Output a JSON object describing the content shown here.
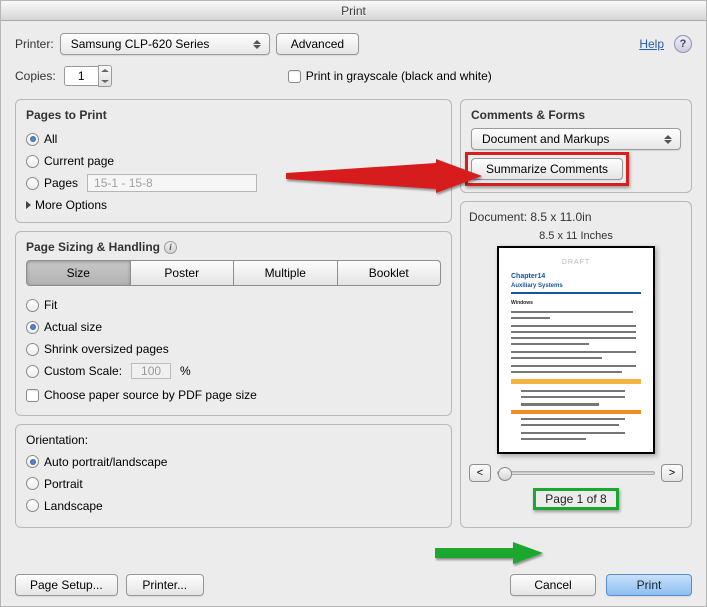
{
  "window_title": "Print",
  "header": {
    "printer_label": "Printer:",
    "printer_value": "Samsung CLP-620 Series",
    "advanced_label": "Advanced",
    "help_label": "Help",
    "copies_label": "Copies:",
    "copies_value": "1",
    "grayscale_label": "Print in grayscale (black and white)"
  },
  "pages_to_print": {
    "title": "Pages to Print",
    "all": "All",
    "current": "Current page",
    "pages": "Pages",
    "pages_value": "15-1 - 15-8",
    "more_options": "More Options"
  },
  "sizing": {
    "title": "Page Sizing & Handling",
    "size": "Size",
    "poster": "Poster",
    "multiple": "Multiple",
    "booklet": "Booklet",
    "fit": "Fit",
    "actual": "Actual size",
    "shrink": "Shrink oversized pages",
    "custom": "Custom Scale:",
    "custom_value": "100",
    "percent": "%",
    "paper_source": "Choose paper source by PDF page size"
  },
  "orientation": {
    "title": "Orientation:",
    "auto": "Auto portrait/landscape",
    "portrait": "Portrait",
    "landscape": "Landscape"
  },
  "comments_forms": {
    "title": "Comments & Forms",
    "value": "Document and Markups",
    "summarize": "Summarize Comments"
  },
  "preview": {
    "doc_dims": "Document: 8.5 x 11.0in",
    "page_dims": "8.5 x 11 Inches",
    "draft": "DRAFT",
    "chapter": "Chapter14",
    "heading": "Auxiliary Systems",
    "sub": "Windows",
    "prev": "<",
    "next": ">",
    "page_counter": "Page 1 of 8"
  },
  "footer": {
    "page_setup": "Page Setup...",
    "printer": "Printer...",
    "cancel": "Cancel",
    "print": "Print"
  }
}
